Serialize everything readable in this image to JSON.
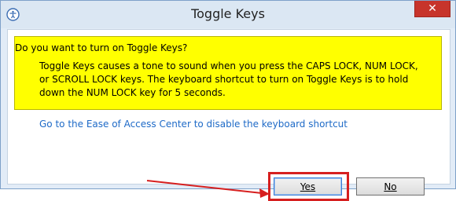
{
  "window": {
    "title": "Toggle Keys",
    "close_glyph": "✕"
  },
  "dialog": {
    "question": "Do you want to turn on Toggle Keys?",
    "description_lines": [
      "Toggle Keys causes a tone to sound when you press the CAPS LOCK, NUM LOCK,",
      "or SCROLL LOCK keys.  The keyboard shortcut to turn on Toggle Keys is to hold",
      "down the NUM LOCK key for 5 seconds."
    ],
    "link": "Go to the Ease of Access Center to disable the keyboard shortcut"
  },
  "buttons": {
    "yes": "Yes",
    "no": "No"
  },
  "colors": {
    "highlight": "#ffff00",
    "annotation": "#d61f1f",
    "link": "#1e6ac7"
  },
  "icons": {
    "app": "ease-of-access-icon",
    "close": "close-icon",
    "arrow": "annotation-arrow-icon"
  }
}
